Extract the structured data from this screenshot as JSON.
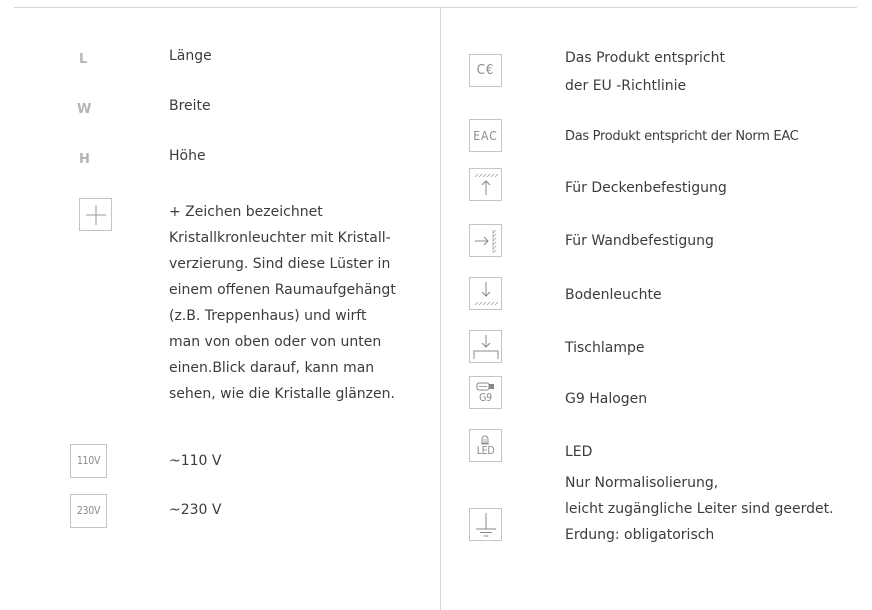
{
  "left": {
    "dimensions": [
      {
        "symbol": "L",
        "label": "Länge"
      },
      {
        "symbol": "W",
        "label": "Breite"
      },
      {
        "symbol": "H",
        "label": "Höhe"
      }
    ],
    "crystal": {
      "icon": "plus-icon",
      "lines": [
        "+ Zeichen bezeichnet",
        "Kristallkronleuchter mit Kristall-",
        "verzierung. Sind diese Lüster in",
        "einem offenen Raumaufgehängt",
        "(z.B. Treppenhaus) und wirft",
        "man von oben oder von unten",
        "einen.Blick darauf, kann man",
        "sehen, wie die Kristalle glänzen."
      ]
    },
    "voltages": [
      {
        "badge": "110V",
        "label": "~110 V"
      },
      {
        "badge": "230V",
        "label": "~230 V"
      }
    ]
  },
  "right": {
    "items": [
      {
        "icon": "ce-mark-icon",
        "badge": "C€",
        "lines": [
          "Das Produkt entspricht",
          "der EU -Richtlinie"
        ]
      },
      {
        "icon": "eac-mark-icon",
        "badge": "EAC",
        "lines": [
          "Das Produkt entspricht der Norm EAC"
        ]
      },
      {
        "icon": "ceiling-mount-icon",
        "lines": [
          "Für Deckenbefestigung"
        ]
      },
      {
        "icon": "wall-mount-icon",
        "lines": [
          "Für Wandbefestigung"
        ]
      },
      {
        "icon": "floor-lamp-icon",
        "lines": [
          "Bodenleuchte"
        ]
      },
      {
        "icon": "table-lamp-icon",
        "lines": [
          "Tischlampe"
        ]
      },
      {
        "icon": "g9-bulb-icon",
        "badge": "G9",
        "lines": [
          "G9 Halogen"
        ]
      },
      {
        "icon": "led-icon",
        "badge": "LED",
        "lines": [
          "LED"
        ]
      },
      {
        "icon": "ground-icon",
        "lines": [
          "Nur Normalisolierung,",
          "leicht zugängliche Leiter sind geerdet.",
          "Erdung: obligatorisch"
        ]
      }
    ]
  },
  "colors": {
    "text": "#3c3c3c",
    "symbol": "#b5b5b5",
    "divider": "#d6d6d6",
    "icon": "#8a8a8a"
  }
}
